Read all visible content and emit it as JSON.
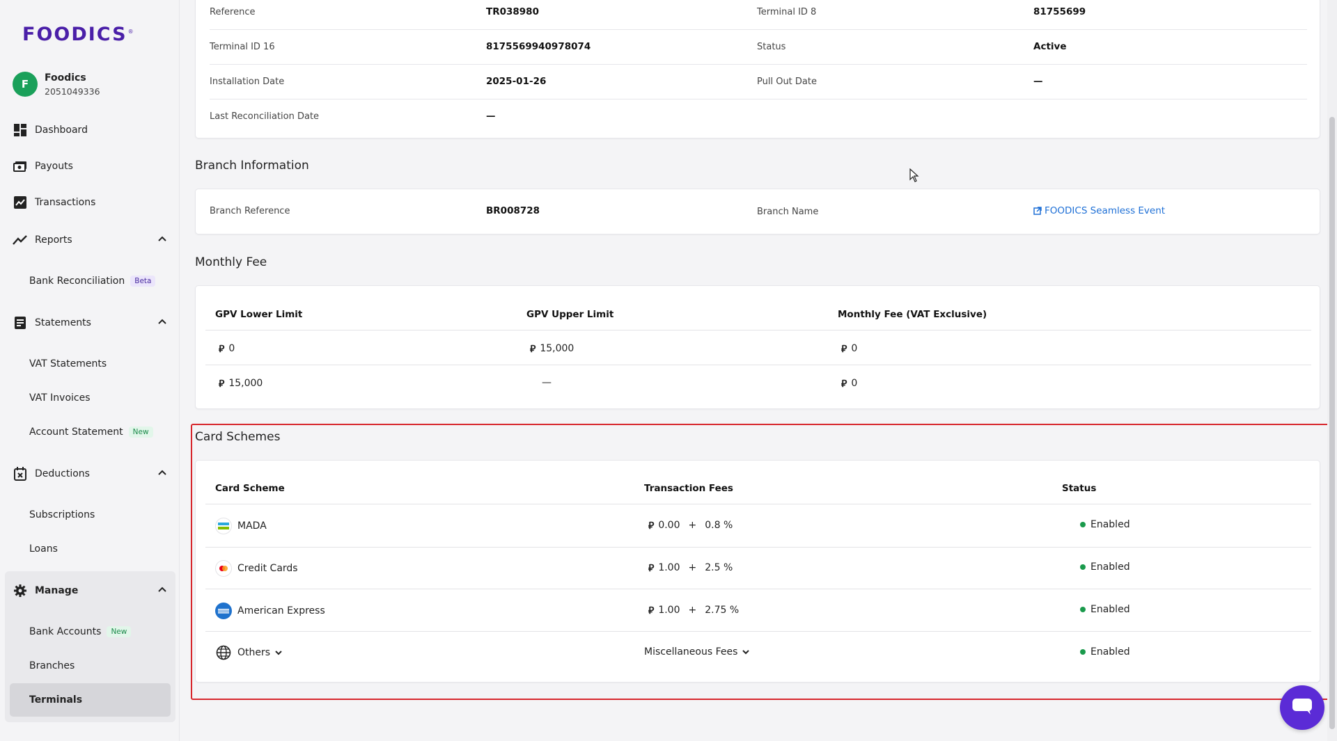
{
  "brand": {
    "logo": "FOODICS",
    "logo_mark": "®",
    "accent": "#4a1fa8"
  },
  "account": {
    "avatar_letter": "F",
    "name": "Foodics",
    "id": "2051049336"
  },
  "sidebar": {
    "dashboard": "Dashboard",
    "payouts": "Payouts",
    "transactions": "Transactions",
    "reports": "Reports",
    "bank_reconciliation": "Bank Reconciliation",
    "beta_badge": "Beta",
    "statements": "Statements",
    "vat_statements": "VAT Statements",
    "vat_invoices": "VAT Invoices",
    "account_statement": "Account Statement",
    "new_badge": "New",
    "deductions": "Deductions",
    "subscriptions": "Subscriptions",
    "loans": "Loans",
    "manage": "Manage",
    "bank_accounts": "Bank Accounts",
    "branches": "Branches",
    "terminals": "Terminals"
  },
  "terminal": {
    "reference_label": "Reference",
    "reference": "TR038980",
    "tid8_label": "Terminal ID 8",
    "tid8": "81755699",
    "tid16_label": "Terminal ID 16",
    "tid16": "8175569940978074",
    "status_label": "Status",
    "status": "Active",
    "install_label": "Installation Date",
    "install": "2025-01-26",
    "pullout_label": "Pull Out Date",
    "pullout": "—",
    "recon_label": "Last Reconciliation Date",
    "recon": "—"
  },
  "branch": {
    "title": "Branch Information",
    "ref_label": "Branch Reference",
    "ref": "BR008728",
    "name_label": "Branch Name",
    "name": "FOODICS Seamless Event"
  },
  "monthly_fee": {
    "title": "Monthly Fee",
    "headers": [
      "GPV Lower Limit",
      "GPV Upper Limit",
      "Monthly Fee (VAT Exclusive)"
    ],
    "rows": [
      {
        "lower": "0",
        "upper": "15,000",
        "fee": "0"
      },
      {
        "lower": "15,000",
        "upper": "—",
        "fee": "0"
      }
    ]
  },
  "card_schemes": {
    "title": "Card Schemes",
    "headers": [
      "Card Scheme",
      "Transaction Fees",
      "Status"
    ],
    "rows": [
      {
        "name": "MADA",
        "fixed": "0.00",
        "plus": "+",
        "pct": "0.8 %",
        "status": "Enabled"
      },
      {
        "name": "Credit Cards",
        "fixed": "1.00",
        "plus": "+",
        "pct": "2.5 %",
        "status": "Enabled"
      },
      {
        "name": "American Express",
        "fixed": "1.00",
        "plus": "+",
        "pct": "2.75 %",
        "status": "Enabled"
      },
      {
        "name": "Others",
        "misc": "Miscellaneous Fees",
        "status": "Enabled"
      }
    ]
  },
  "colors": {
    "status_enabled": "#1a9a4c",
    "link": "#1d6fd6",
    "highlight": "#d7262c",
    "chat": "#5b2bd6"
  }
}
